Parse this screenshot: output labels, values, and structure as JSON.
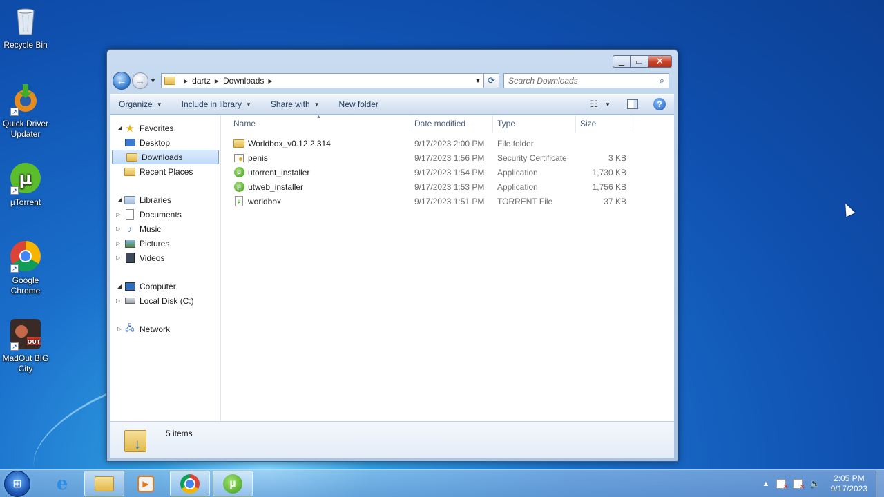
{
  "desktop": {
    "icons": [
      {
        "label": "Recycle Bin",
        "icon": "recycle-bin-icon"
      },
      {
        "label": "Quick Driver Updater",
        "icon": "driver-updater-icon"
      },
      {
        "label": "µTorrent",
        "icon": "utorrent-icon"
      },
      {
        "label": "Google Chrome",
        "icon": "chrome-icon"
      },
      {
        "label": "MadOut BIG City",
        "icon": "madout-icon"
      }
    ]
  },
  "window": {
    "address": {
      "crumbs": [
        "dartz",
        "Downloads"
      ]
    },
    "search": {
      "placeholder": "Search Downloads"
    },
    "toolbar": {
      "organize": "Organize",
      "include_in_library": "Include in library",
      "share_with": "Share with",
      "new_folder": "New folder"
    },
    "nav": {
      "favorites": {
        "label": "Favorites",
        "items": [
          "Desktop",
          "Downloads",
          "Recent Places"
        ],
        "selected": "Downloads"
      },
      "libraries": {
        "label": "Libraries",
        "items": [
          "Documents",
          "Music",
          "Pictures",
          "Videos"
        ]
      },
      "computer": {
        "label": "Computer",
        "items": [
          "Local Disk (C:)"
        ]
      },
      "network": {
        "label": "Network"
      }
    },
    "columns": {
      "name": "Name",
      "date": "Date modified",
      "type": "Type",
      "size": "Size"
    },
    "files": [
      {
        "name": "Worldbox_v0.12.2.314",
        "date": "9/17/2023 2:00 PM",
        "type": "File folder",
        "size": "",
        "icon": "folder-icon"
      },
      {
        "name": "penis",
        "date": "9/17/2023 1:56 PM",
        "type": "Security Certificate",
        "size": "3 KB",
        "icon": "certificate-icon"
      },
      {
        "name": "utorrent_installer",
        "date": "9/17/2023 1:54 PM",
        "type": "Application",
        "size": "1,730 KB",
        "icon": "utorrent-icon"
      },
      {
        "name": "utweb_installer",
        "date": "9/17/2023 1:53 PM",
        "type": "Application",
        "size": "1,756 KB",
        "icon": "utorrent-icon"
      },
      {
        "name": "worldbox",
        "date": "9/17/2023 1:51 PM",
        "type": "TORRENT File",
        "size": "37 KB",
        "icon": "torrent-file-icon"
      }
    ],
    "status": {
      "items_count": "5 items"
    }
  },
  "taskbar": {
    "clock_time": "2:05 PM",
    "clock_date": "9/17/2023",
    "apps": [
      "internet-explorer-icon",
      "windows-explorer-icon",
      "media-player-icon",
      "chrome-icon",
      "utorrent-icon"
    ]
  }
}
